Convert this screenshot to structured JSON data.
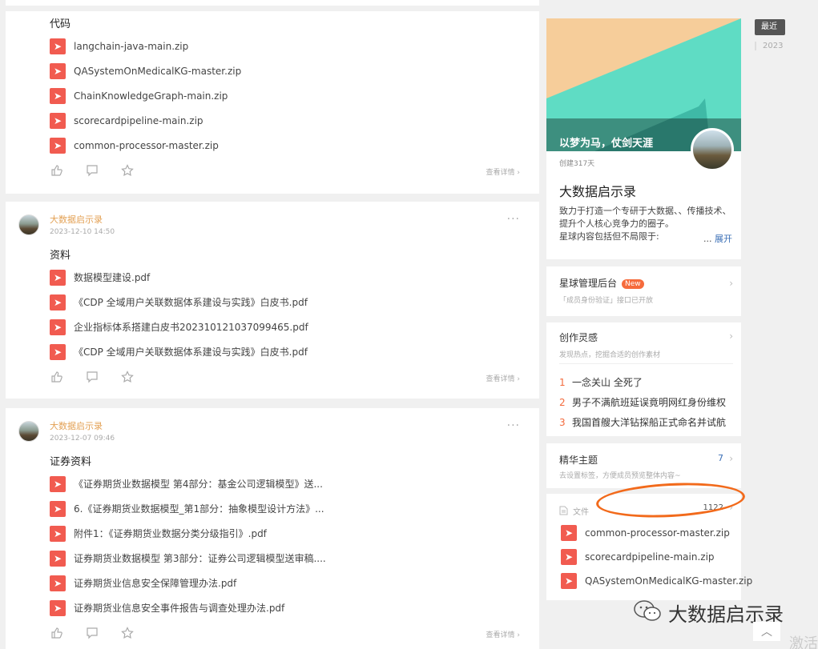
{
  "posts": [
    {
      "title": "代码",
      "files": [
        "langchain-java-main.zip",
        "QASystemOnMedicalKG-master.zip",
        "ChainKnowledgeGraph-main.zip",
        "scorecardpipeline-main.zip",
        "common-processor-master.zip"
      ],
      "view_detail": "查看详情"
    },
    {
      "author": "大数据启示录",
      "date": "2023-12-10 14:50",
      "title": "资料",
      "files": [
        "数据模型建设.pdf",
        "《CDP 全域用户关联数据体系建设与实践》白皮书.pdf",
        "企业指标体系搭建白皮书20231012103709946​5.pdf",
        "《CDP 全域用户关联数据体系建设与实践》白皮书.pdf"
      ],
      "view_detail": "查看详情"
    },
    {
      "author": "大数据启示录",
      "date": "2023-12-07 09:46",
      "title": "证券资料",
      "files": [
        "《证券期货业数据模型 第4部分：基金公司逻辑模型》送...",
        "6.《证券期货业数据模型_第1部分：抽象模型设计方法》...",
        "附件1：《证券期货业数据分类分级指引》.pdf",
        "证券期货业数据模型 第3部分：证券公司逻辑模型送审稿....",
        "证券期货业信息安全保障管理办法.pdf",
        "证券期货业信息安全事件报告与调查处理办法.pdf"
      ],
      "view_detail": "查看详情"
    }
  ],
  "star": {
    "slogan": "以梦为马，仗剑天涯",
    "created": "创建317天",
    "name": "大数据启示录",
    "desc": "致力于打造一个专研于大数据、、传播技术、提升个人核心竞争力的圈子。",
    "desc2": "星球内容包括但不局限于:",
    "expand_prefix": "... ",
    "expand": "展开"
  },
  "admin": {
    "title": "星球管理后台",
    "badge": "New",
    "sub": "「成员身份验证」接口已开放"
  },
  "inspire": {
    "title": "创作灵感",
    "sub": "发现热点，挖掘合适的创作素材",
    "items": [
      {
        "rank": "1",
        "text": "一念关山 全死了"
      },
      {
        "rank": "2",
        "text": "男子不满航班延误竟明网红身份维权"
      },
      {
        "rank": "3",
        "text": "我国首艘大洋钻探船正式命名并试航"
      }
    ]
  },
  "featured": {
    "title": "精华主题",
    "count": "7",
    "sub": "去设置标签，方便成员预览整体内容~"
  },
  "files_card": {
    "title": "文件",
    "count": "1122",
    "items": [
      "common-processor-master.zip",
      "scorecardpipeline-main.zip",
      "QASystemOnMedicalKG-master.zip"
    ]
  },
  "timeline": {
    "active": "最近",
    "year": "2023"
  },
  "watermark": "大数据启示录",
  "corner": "激活"
}
